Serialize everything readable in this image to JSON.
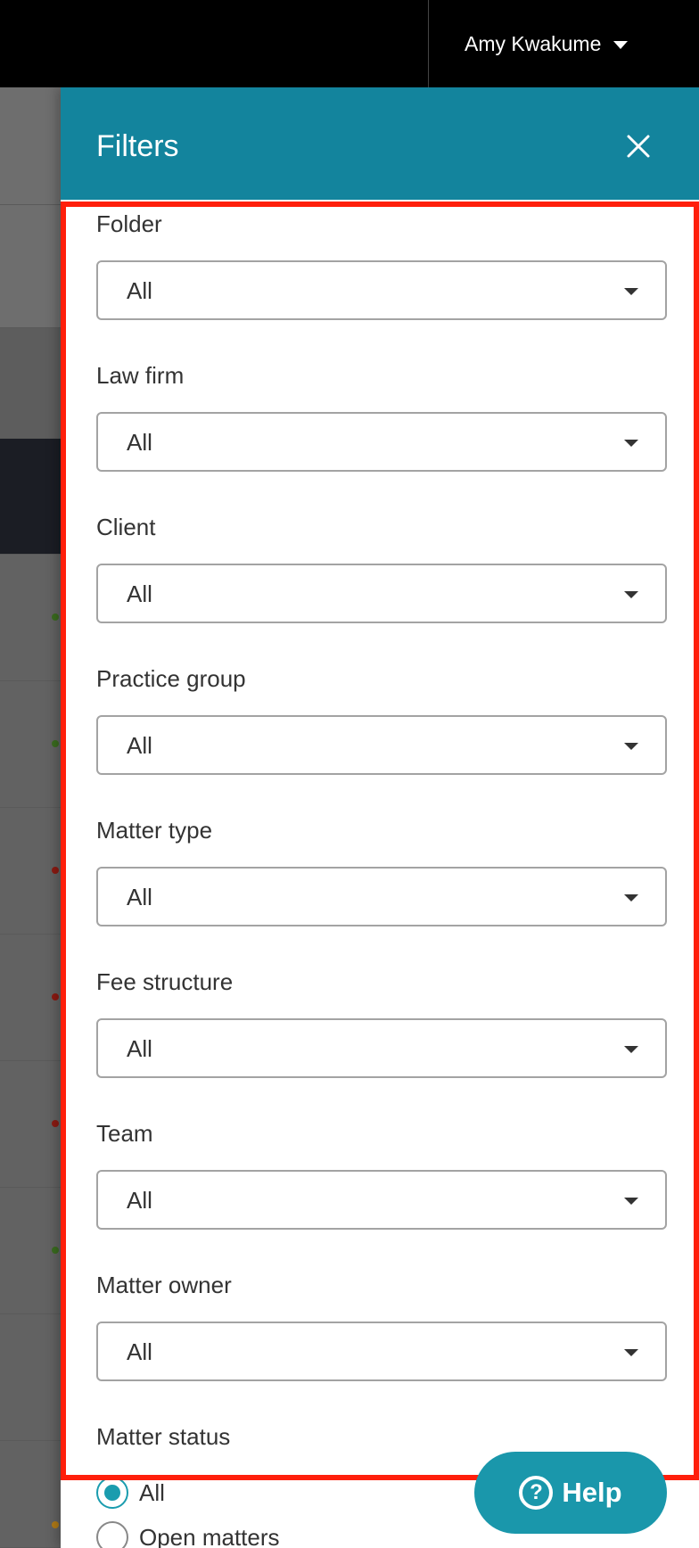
{
  "topbar": {
    "user_name": "Amy Kwakume"
  },
  "panel": {
    "title": "Filters",
    "filters": [
      {
        "label": "Folder",
        "value": "All"
      },
      {
        "label": "Law firm",
        "value": "All"
      },
      {
        "label": "Client",
        "value": "All"
      },
      {
        "label": "Practice group",
        "value": "All"
      },
      {
        "label": "Matter type",
        "value": "All"
      },
      {
        "label": "Fee structure",
        "value": "All"
      },
      {
        "label": "Team",
        "value": "All"
      },
      {
        "label": "Matter owner",
        "value": "All"
      }
    ],
    "matter_status": {
      "label": "Matter status",
      "options": [
        {
          "label": "All",
          "selected": true
        },
        {
          "label": "Open matters",
          "selected": false
        }
      ]
    }
  },
  "help": {
    "label": "Help",
    "icon_glyph": "?"
  },
  "colors": {
    "header_teal": "#13849d",
    "accent_teal": "#1a9cae",
    "highlight_red": "#ff1f0b",
    "status_dots": [
      "#3a6b1f",
      "#3a6b1f",
      "#8a1a12",
      "#8a1a12",
      "#8a1a12",
      "#3a6b1f",
      "#b07a16"
    ]
  }
}
